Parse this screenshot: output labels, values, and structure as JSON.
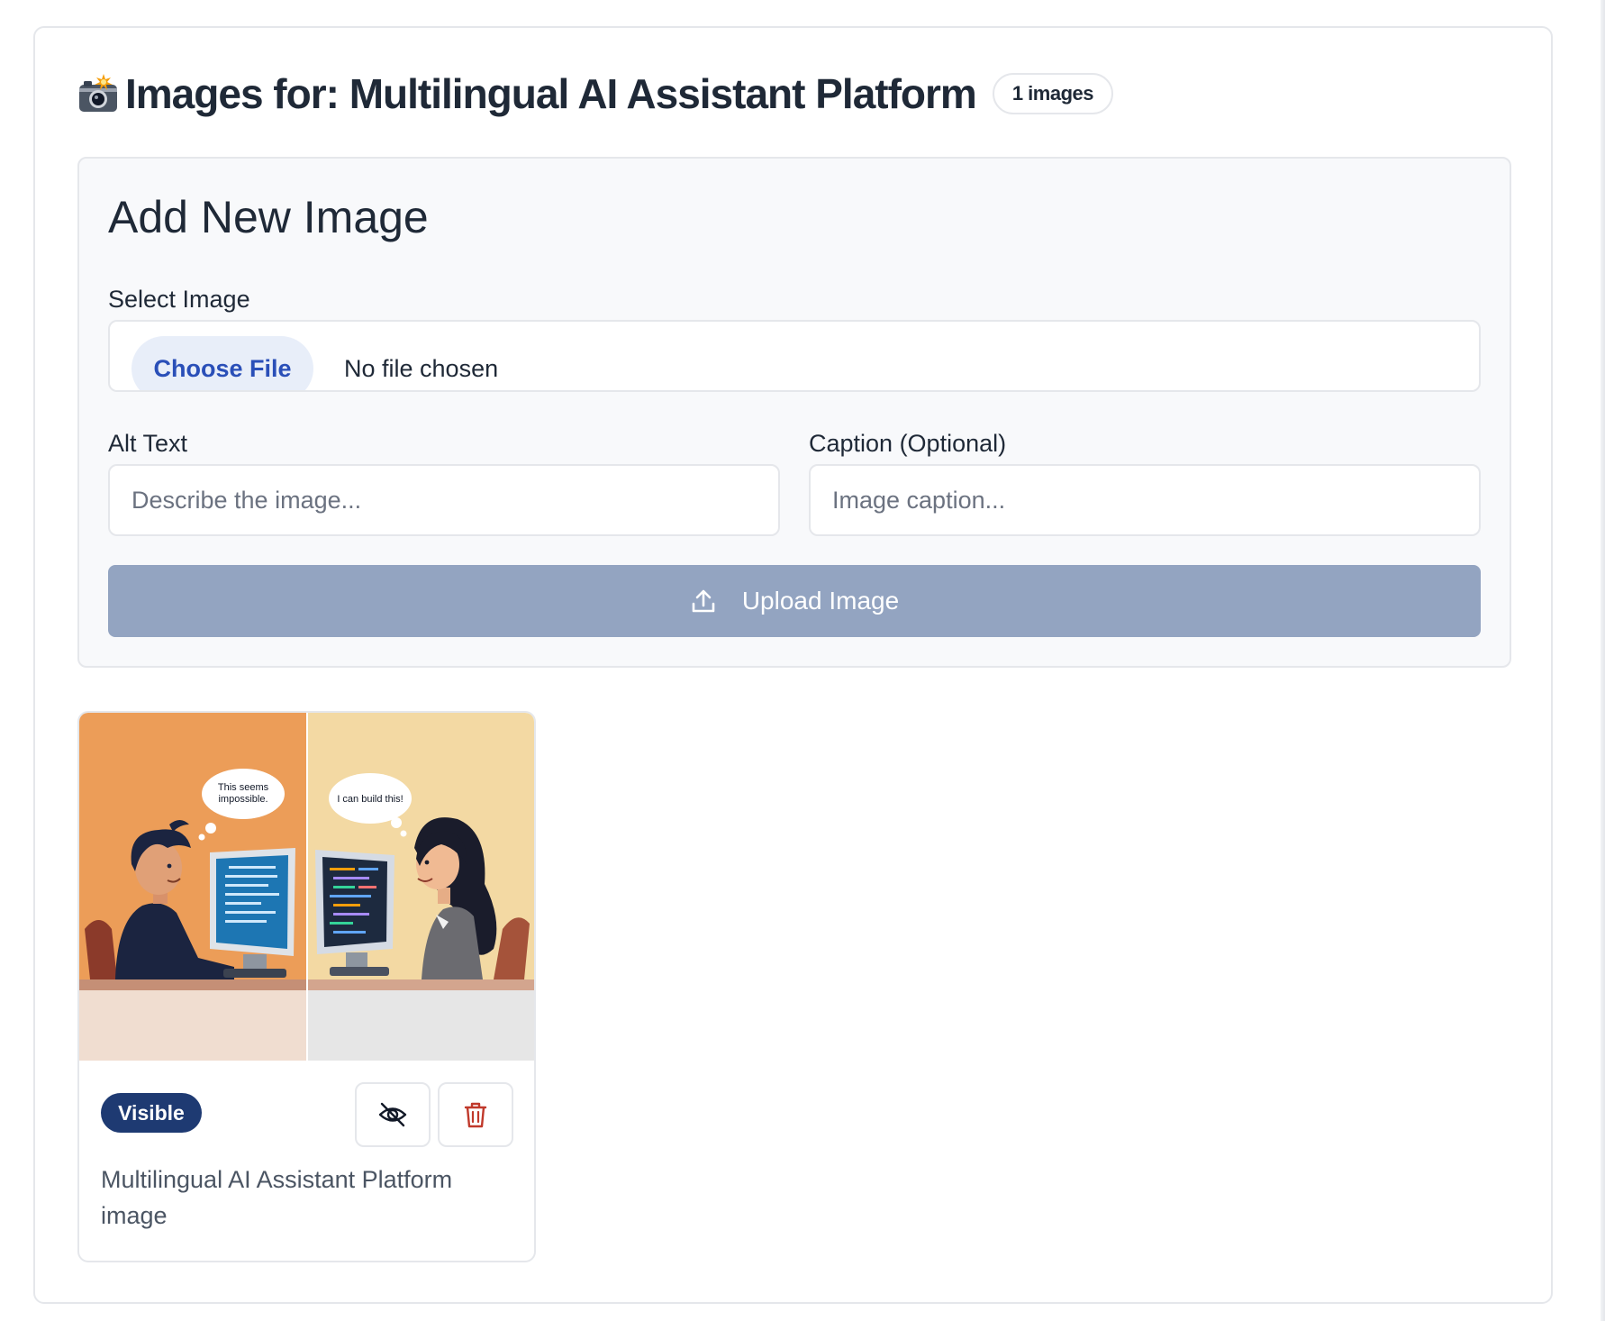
{
  "header": {
    "title": "Images for: Multilingual AI Assistant Platform",
    "count_badge": "1 images",
    "icon": "camera-flash-icon"
  },
  "add_image": {
    "title": "Add New Image",
    "select_label": "Select Image",
    "choose_file_label": "Choose File",
    "file_status": "No file chosen",
    "alt_label": "Alt Text",
    "alt_placeholder": "Describe the image...",
    "alt_value": "",
    "caption_label": "Caption (Optional)",
    "caption_placeholder": "Image caption...",
    "caption_value": "",
    "upload_label": "Upload Image",
    "upload_icon": "upload-icon"
  },
  "images": [
    {
      "status": "Visible",
      "caption": "Multilingual AI Assistant Platform image",
      "bubble_left": "This seems impossible.",
      "bubble_right": "I can build this!",
      "actions": [
        "eye-off-icon",
        "trash-icon"
      ]
    }
  ],
  "colors": {
    "accent_blue": "#2a4fb8",
    "badge_navy": "#1e3a72",
    "upload_disabled": "#93a4c1",
    "delete_red": "#c0392b"
  }
}
